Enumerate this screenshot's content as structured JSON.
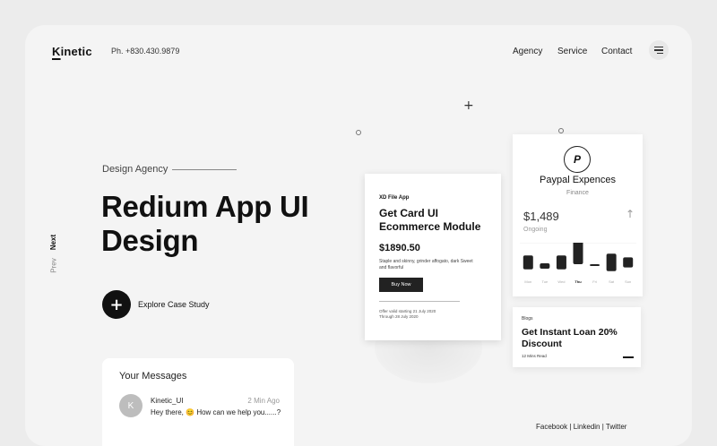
{
  "header": {
    "logo": "Kinetic",
    "phone": "Ph. +830.430.9879",
    "nav": [
      "Agency",
      "Service",
      "Contact"
    ]
  },
  "hero": {
    "eyebrow": "Design Agency",
    "title_line1": "Redium App UI",
    "title_line2": "Design",
    "next_label": "Next",
    "prev_label": "Prev",
    "cta_icon": "+",
    "cta_label": "Explore Case Study"
  },
  "messages": {
    "title": "Your Messages",
    "avatar_initial": "K",
    "sender": "Kinetic_UI",
    "time": "2 Min Ago",
    "text": "Hey there, 😊 How can we help you......?"
  },
  "product_card": {
    "tag": "XD File App",
    "title": "Get Card UI Ecommerce Module",
    "price": "$1890.50",
    "description": "Staple and skinny, grinder affogato, dark Sweet and flavorful",
    "button": "Buy Now",
    "offer_line1": "Offer valid starting 21 July 2020",
    "offer_line2": "Through 28 July 2020"
  },
  "paypal_card": {
    "logo": "P",
    "title": "Paypal Expences",
    "subtitle": "Finance",
    "amount": "$1,489",
    "status": "Ongoing",
    "arrow_icon": "arrow-up-icon",
    "chart_data": {
      "type": "bar",
      "categories": [
        "Mon",
        "Tue",
        "Wed",
        "Thu",
        "Fri",
        "Sat",
        "Sun"
      ],
      "values": [
        0.55,
        0.25,
        0.55,
        1.0,
        0.1,
        0.7,
        0.4
      ]
    }
  },
  "blog_card": {
    "category": "Blogs",
    "title": "Get Instant Loan 20% Discount",
    "read_time": "12 Mins Read"
  },
  "social": {
    "links": [
      "Facebook",
      "Linkedin",
      "Twitter"
    ],
    "separator": "|"
  },
  "colors": {
    "accent": "#111111",
    "background": "#f4f4f4",
    "card": "#ffffff"
  }
}
